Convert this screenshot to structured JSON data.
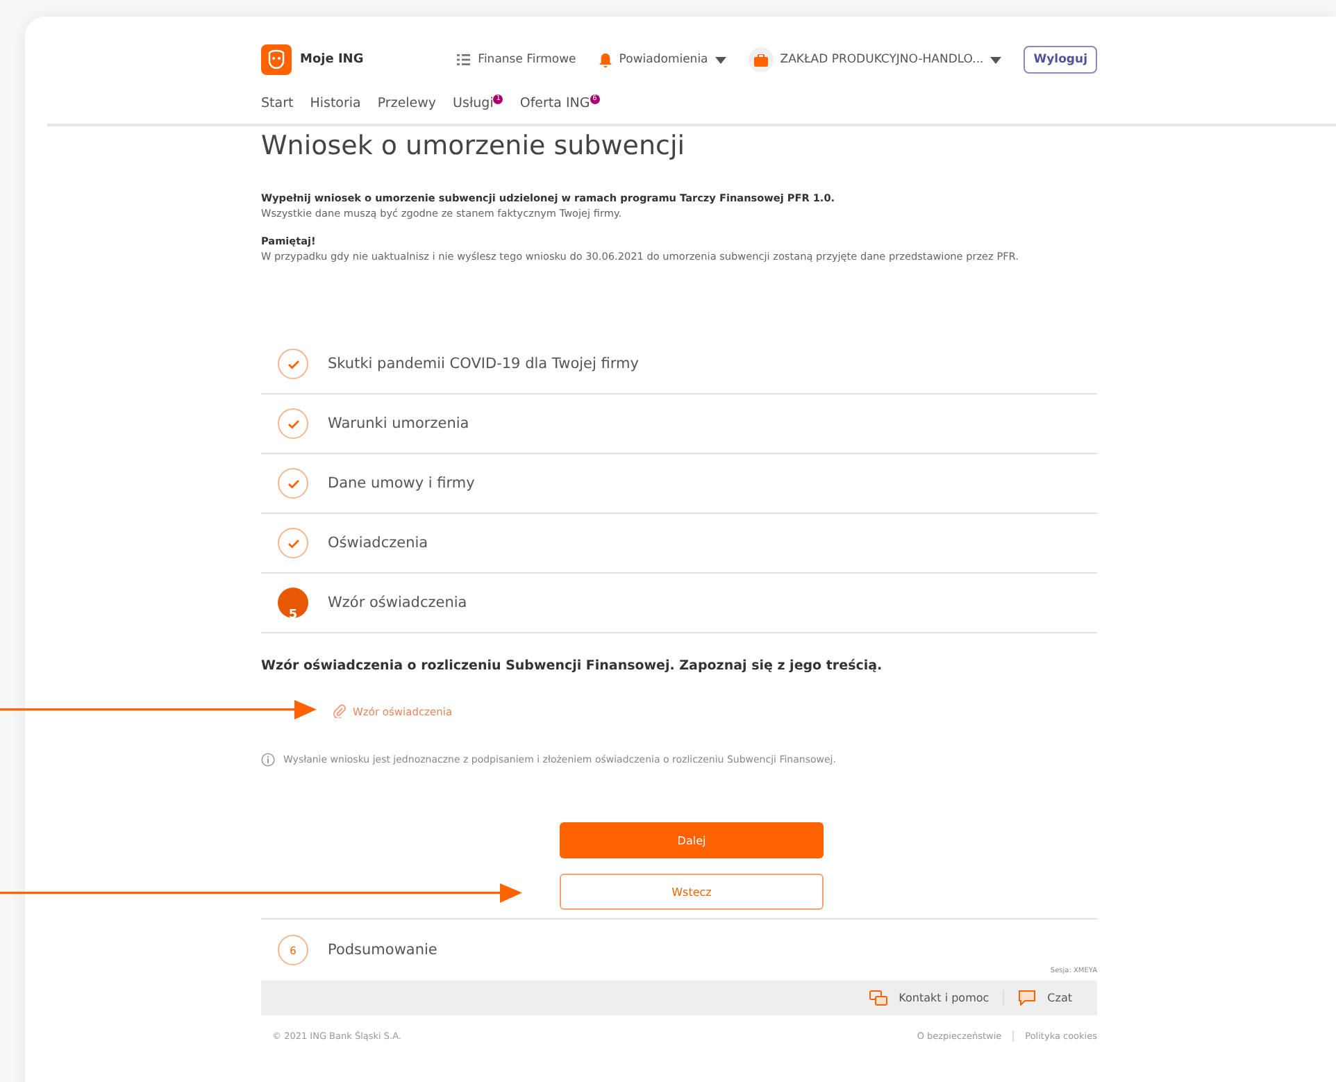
{
  "header": {
    "logo_text": "Moje ING",
    "links": [
      {
        "kind": "menu",
        "label": "Finanse Firmowe",
        "dropdown": false
      },
      {
        "kind": "bell",
        "label": "Powiadomienia",
        "dropdown": true
      },
      {
        "kind": "company",
        "label": "ZAKŁAD PRODUKCYJNO-HANDLO...",
        "dropdown": true
      }
    ],
    "logout": "Wyloguj"
  },
  "nav": [
    {
      "label": "Start"
    },
    {
      "label": "Historia"
    },
    {
      "label": "Przelewy"
    },
    {
      "label": "Usługi",
      "badge": "1"
    },
    {
      "label": "Oferta ING",
      "badge": "6"
    }
  ],
  "title": "Wniosek o umorzenie subwencji",
  "intro": {
    "lead": "Wypełnij wniosek o umorzenie subwencji udzielonej w ramach programu Tarczy Finansowej PFR 1.0.",
    "sub": "Wszystkie dane muszą być zgodne ze stanem faktycznym Twojej firmy.",
    "remember_title": "Pamiętaj!",
    "remember_text": "W przypadku gdy nie uaktualnisz i nie wyślesz tego wniosku do 30.06.2021 do umorzenia subwencji zostaną przyjęte dane przedstawione przez PFR."
  },
  "steps": [
    {
      "label": "Skutki pandemii COVID-19 dla Twojej firmy",
      "completed": true,
      "current": false
    },
    {
      "label": "Warunki umorzenia",
      "completed": true,
      "current": false
    },
    {
      "label": "Dane umowy i firmy",
      "completed": true,
      "current": false
    },
    {
      "label": "Oświadczenia",
      "completed": true,
      "current": false
    },
    {
      "number": "5",
      "label": "Wzór oświadczenia",
      "completed": false,
      "current": true
    }
  ],
  "current_step": {
    "heading": "Wzór oświadczenia o rozliczeniu Subwencji Finansowej. Zapoznaj się z jego treścią.",
    "attachment": "Wzór oświadczenia",
    "info": "Wysłanie wniosku jest jednoznaczne z podpisaniem i złożeniem oświadczenia o rozliczeniu Subwencji Finansowej.",
    "buttons": [
      {
        "label": "Dalej",
        "kind": "primary"
      },
      {
        "label": "Wstecz",
        "kind": "secondary"
      }
    ]
  },
  "next_steps": [
    {
      "number": "6",
      "label": "Podsumowanie",
      "completed": false,
      "current": false
    }
  ],
  "session": "Sesja: XMEYA",
  "footer": {
    "links": [
      {
        "kind": "contact",
        "label": "Kontakt i pomoc"
      },
      {
        "kind": "chat",
        "label": "Czat"
      }
    ],
    "copyright": "© 2021 ING Bank Śląski S.A.",
    "legal": [
      "O bezpieczeństwie",
      "Polityka cookies"
    ]
  }
}
